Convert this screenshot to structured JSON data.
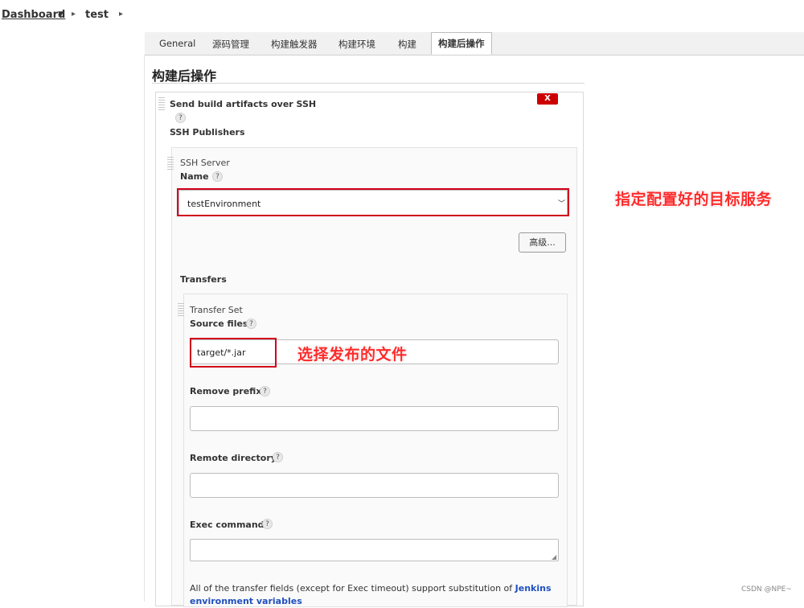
{
  "breadcrumb": {
    "dashboard": "Dashboard",
    "job": "test"
  },
  "tabs": [
    {
      "label": "General"
    },
    {
      "label": "源码管理"
    },
    {
      "label": "构建触发器"
    },
    {
      "label": "构建环境"
    },
    {
      "label": "构建"
    },
    {
      "label": "构建后操作",
      "active": true
    }
  ],
  "section": {
    "title": "构建后操作"
  },
  "publisher": {
    "title": "Send build artifacts over SSH",
    "help": "?",
    "delete_label": "X",
    "publishers_label": "SSH Publishers"
  },
  "server": {
    "heading": "SSH Server",
    "name_label": "Name",
    "selected": "testEnvironment",
    "advanced_label": "高级...",
    "transfers_label": "Transfers"
  },
  "transfer": {
    "heading": "Transfer Set",
    "source_label": "Source files",
    "source_value": "target/*.jar",
    "remove_prefix_label": "Remove prefix",
    "remote_dir_label": "Remote directory",
    "exec_label": "Exec command",
    "footnote_text": "All of the transfer fields (except for Exec timeout) support substitution of ",
    "footnote_link": "Jenkins environment variables"
  },
  "annotations": {
    "server_note": "指定配置好的目标服务",
    "source_note": "选择发布的文件"
  },
  "watermark": "CSDN @NPE~",
  "colors": {
    "annotation": "#d0021b",
    "delete": "#cc0000",
    "link": "#1f4fbf"
  }
}
